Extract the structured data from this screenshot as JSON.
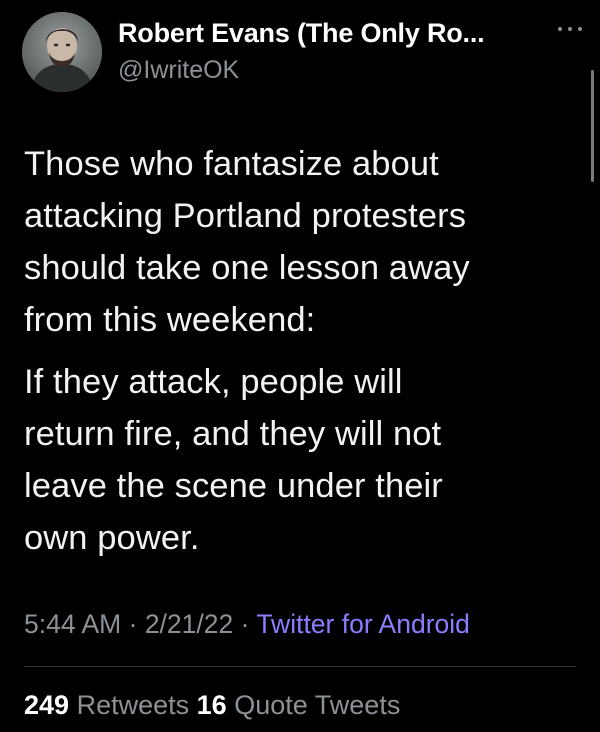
{
  "author": {
    "name": "Robert Evans (The Only Ro...",
    "handle": "@IwriteOK",
    "avatar_icon": "profile-photo"
  },
  "tweet": {
    "paragraphs": [
      "Those who fantasize about\nattacking Portland protesters\nshould take one lesson away\nfrom this weekend:",
      "If they attack, people will\nreturn fire, and they will not\nleave the scene under their\nown power."
    ]
  },
  "meta": {
    "time": "5:44 AM",
    "separator": "·",
    "date": "2/21/22",
    "source": "Twitter for Android"
  },
  "stats": {
    "retweets_count": "249",
    "retweets_label": "Retweets",
    "quotes_count": "16",
    "quotes_label": "Quote Tweets"
  },
  "colors": {
    "background": "#000000",
    "text": "#e7e9ea",
    "secondary": "#8b9196",
    "link": "#8b7dff"
  },
  "icons": {
    "more": "more-horizontal-icon"
  }
}
